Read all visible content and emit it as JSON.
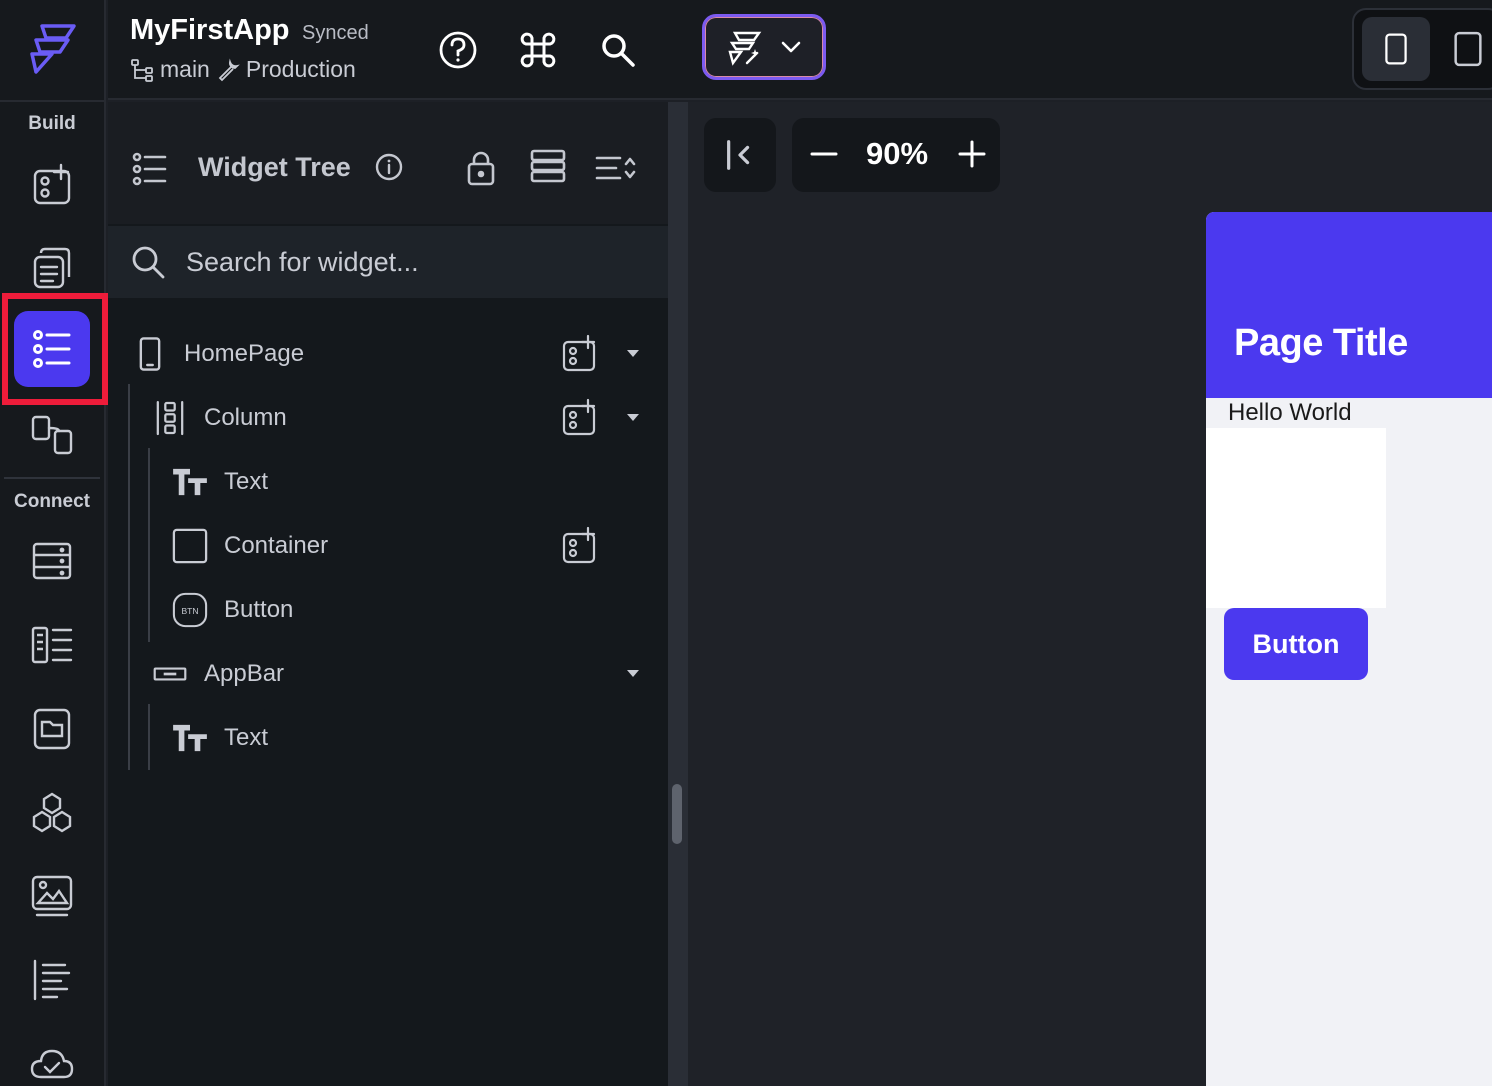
{
  "header": {
    "app_name": "MyFirstApp",
    "sync_status": "Synced",
    "branch": "main",
    "environment": "Production"
  },
  "rail": {
    "build_label": "Build",
    "connect_label": "Connect",
    "active_item": "widget-tree",
    "items_build": [
      "add-widget",
      "pages",
      "widget-tree",
      "storyboard"
    ],
    "items_connect": [
      "firestore",
      "app-state",
      "files",
      "integrations",
      "media-assets",
      "api-calls",
      "cloud-functions"
    ]
  },
  "widget_tree": {
    "title": "Widget Tree",
    "search_placeholder": "Search for widget...",
    "nodes": [
      {
        "label": "HomePage",
        "icon": "phone-icon"
      },
      {
        "label": "Column",
        "icon": "column-icon"
      },
      {
        "label": "Text",
        "icon": "text-icon"
      },
      {
        "label": "Container",
        "icon": "container-icon"
      },
      {
        "label": "Button",
        "icon": "button-icon",
        "icon_text": "BTN"
      },
      {
        "label": "AppBar",
        "icon": "appbar-icon"
      },
      {
        "label": "Text",
        "icon": "text-icon"
      }
    ]
  },
  "canvas": {
    "zoom": "90%",
    "preview": {
      "page_title": "Page Title",
      "text": "Hello World",
      "button_label": "Button"
    }
  },
  "colors": {
    "accent": "#4b39ef",
    "highlight": "#ee1c3a",
    "panel_bg": "#14181c",
    "rail_bg": "#16191d"
  }
}
